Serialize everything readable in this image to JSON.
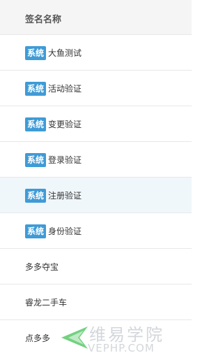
{
  "table": {
    "header": "签名名称",
    "rows": [
      {
        "badge": "系统",
        "name": "大鱼测试"
      },
      {
        "badge": "系统",
        "name": "活动验证"
      },
      {
        "badge": "系统",
        "name": "变更验证"
      },
      {
        "badge": "系统",
        "name": "登录验证"
      },
      {
        "badge": "系统",
        "name": "注册验证"
      },
      {
        "badge": "系统",
        "name": "身份验证"
      },
      {
        "badge": "",
        "name": "多多夺宝"
      },
      {
        "badge": "",
        "name": "睿龙二手车"
      },
      {
        "badge": "",
        "name": "点多多"
      }
    ]
  },
  "watermark": {
    "chinese": "维易学院",
    "english": "VEPHP.COM"
  },
  "colors": {
    "badge": "#3f9bd6",
    "header_bg": "#f5f5f6",
    "highlight_row": "#f0f7fb",
    "logo_green": "#5cc96b"
  }
}
